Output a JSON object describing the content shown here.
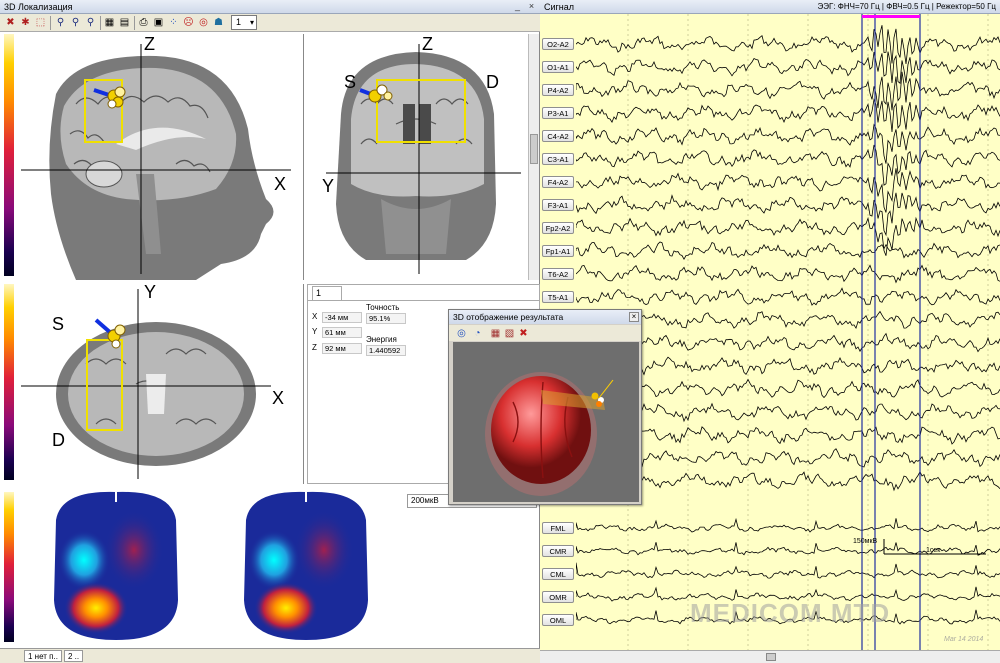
{
  "left_window": {
    "title": "3D Локализация",
    "slice_value": "1"
  },
  "views": {
    "sagittal": {
      "axis_vertical": "Z",
      "axis_horizontal": "X"
    },
    "coronal": {
      "axis_vertical": "Z",
      "axis_horizontal": "Y",
      "left_side": "S",
      "right_side": "D"
    },
    "axial": {
      "axis_vertical": "Y",
      "axis_horizontal": "X",
      "top_side": "S",
      "bottom_side": "D"
    }
  },
  "info": {
    "tab": "1",
    "x_label": "X",
    "x_value": "-34 мм",
    "y_label": "Y",
    "y_value": "61 мм",
    "z_label": "Z",
    "z_value": "92 мм",
    "accuracy_label": "Точность",
    "accuracy_value": "95.1%",
    "energy_label": "Энергия",
    "energy_value": "1.440592"
  },
  "amplitude_select": "200мкВ",
  "bottom_tabs": [
    "1 нет п..",
    "2 .."
  ],
  "popup3d": {
    "title": "3D отображение  результата",
    "close": "×"
  },
  "signal_window": {
    "title": "Сигнал",
    "filter_info": "ЭЭГ: ФНЧ=70 Гц | ФВЧ=0.5 Гц | Режектор=50 Гц",
    "channels_top": [
      "O2-A2",
      "O1-A1",
      "P4-A2",
      "P3-A1",
      "C4-A2",
      "C3-A1",
      "F4-A2",
      "F3-A1",
      "Fp2-A2",
      "Fp1-A1",
      "T6-A2",
      "T5-A1"
    ],
    "channels_bottom": [
      "FML",
      "CMR",
      "CML",
      "OMR",
      "OML"
    ],
    "scale_amplitude": "150мкВ",
    "scale_time": "1сек"
  },
  "watermark": "MEDICOM MTD",
  "watermark_date": "Mar 14 2014",
  "colors": {
    "signal_bg": "#ffffc6",
    "marker": "#ff00ff",
    "cursor_lines": "#2030a0",
    "roi_box": "#f0e000"
  }
}
